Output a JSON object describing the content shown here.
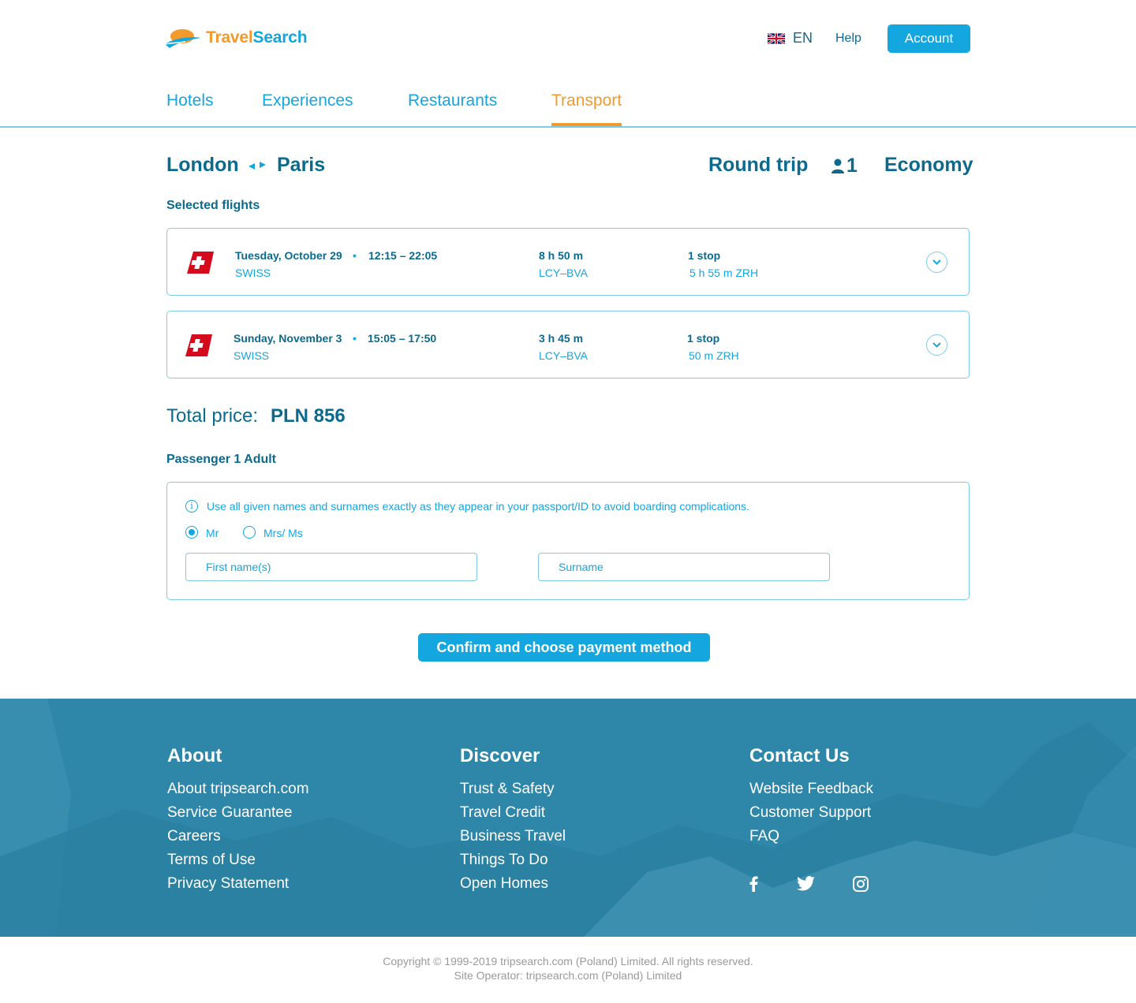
{
  "brand": {
    "part1": "Travel",
    "part2": "Search"
  },
  "header": {
    "language": "EN",
    "help_label": "Help",
    "account_label": "Account"
  },
  "nav": {
    "tabs": [
      {
        "label": "Hotels"
      },
      {
        "label": "Experiences"
      },
      {
        "label": "Restaurants"
      },
      {
        "label": "Transport",
        "active": true
      }
    ]
  },
  "trip": {
    "origin": "London",
    "destination": "Paris",
    "trip_type": "Round trip",
    "passengers": "1",
    "cabin": "Economy"
  },
  "selected_flights": {
    "label": "Selected flights",
    "items": [
      {
        "date": "Tuesday, October 29",
        "dot": "•",
        "time": "12:15 – 22:05",
        "airline": "SWISS",
        "duration": "8 h 50 m",
        "airports": "LCY–BVA",
        "stops": "1 stop",
        "stop_detail": "5 h 55 m ZRH"
      },
      {
        "date": "Sunday, November 3",
        "dot": "•",
        "time": "15:05 – 17:50",
        "airline": "SWISS",
        "duration": "3 h 45 m",
        "airports": "LCY–BVA",
        "stops": "1 stop",
        "stop_detail": "50 m ZRH"
      }
    ]
  },
  "price": {
    "label": "Total price:",
    "value": "PLN 856"
  },
  "passenger": {
    "heading": "Passenger 1 Adult",
    "info": "Use all given names and surnames exactly as they appear in your passport/ID to avoid boarding complications.",
    "title_options": [
      {
        "label": "Mr",
        "checked": true
      },
      {
        "label": "Mrs/ Ms",
        "checked": false
      }
    ],
    "first_name_placeholder": "First name(s)",
    "surname_placeholder": "Surname"
  },
  "confirm_label": "Confirm and choose payment method",
  "footer": {
    "columns": [
      {
        "title": "About",
        "links": [
          "About tripsearch.com",
          "Service Guarantee",
          "Careers",
          "Terms of Use",
          "Privacy Statement"
        ]
      },
      {
        "title": "Discover",
        "links": [
          "Trust & Safety",
          "Travel Credit",
          "Business Travel",
          "Things To Do",
          "Open Homes"
        ]
      },
      {
        "title": "Contact Us",
        "links": [
          "Website Feedback",
          "Customer Support",
          "FAQ"
        ]
      }
    ],
    "social": [
      "facebook-icon",
      "twitter-icon",
      "instagram-icon"
    ],
    "copyright": "Copyright © 1999-2019 tripsearch.com (Poland) Limited. All rights reserved.",
    "operator": "Site Operator: tripsearch.com (Poland) Limited"
  },
  "colors": {
    "primary": "#14a6df",
    "dark": "#0b6a8e",
    "accent": "#f29b2c",
    "footer": "#2d86a8"
  }
}
